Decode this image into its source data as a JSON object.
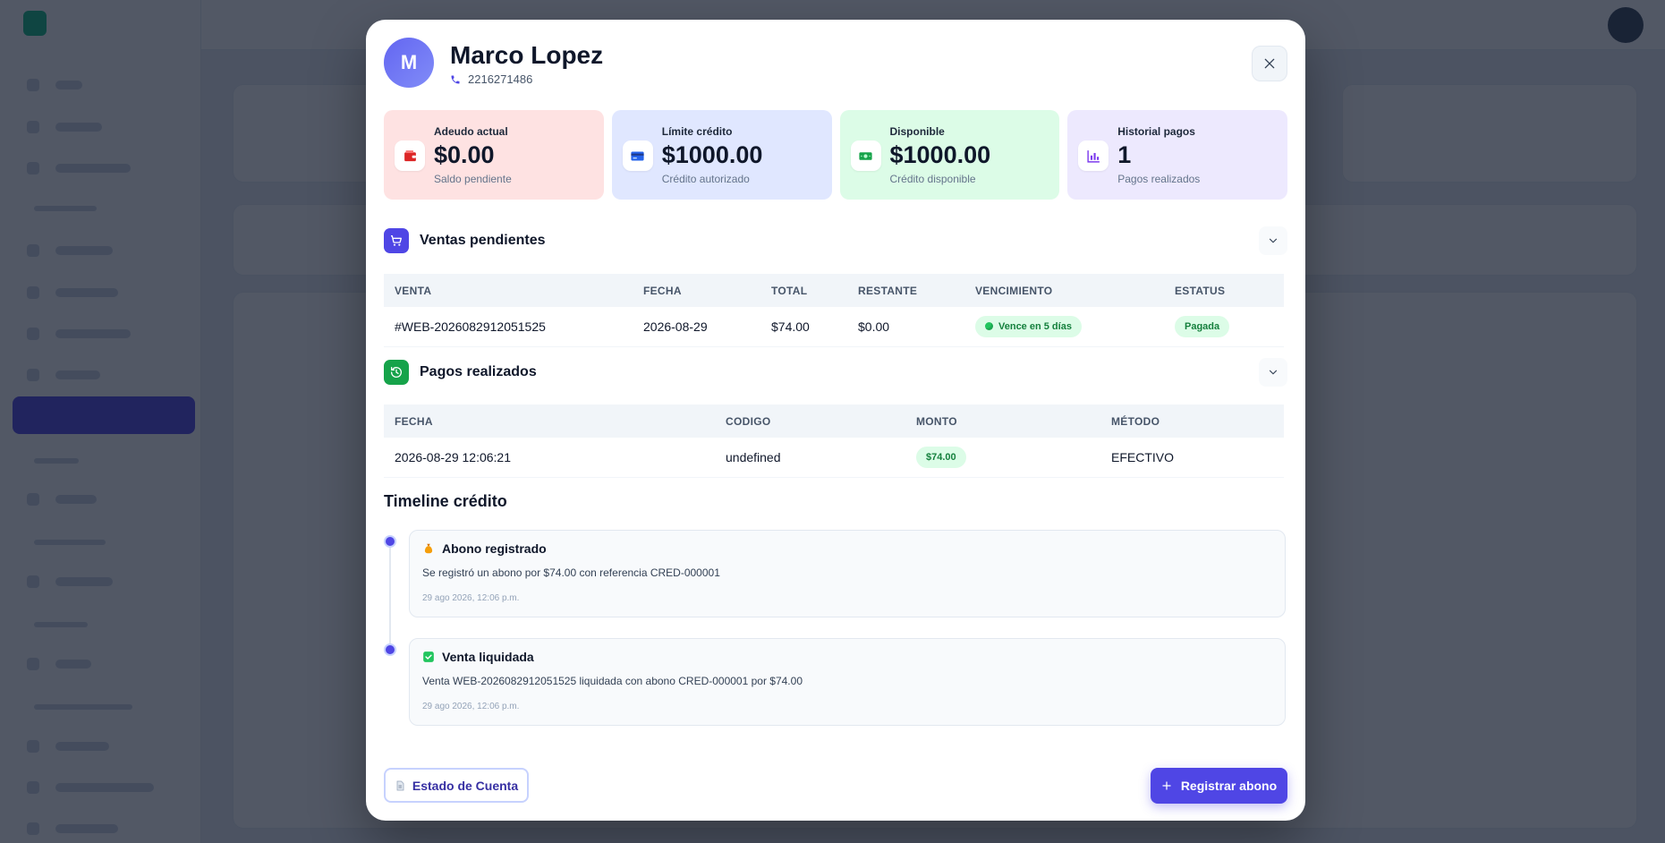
{
  "client": {
    "initial": "M",
    "name": "Marco Lopez",
    "phone": "2216271486"
  },
  "stats": [
    {
      "label": "Adeudo actual",
      "value": "$0.00",
      "sub": "Saldo pendiente",
      "icon": "wallet-icon",
      "bg": "#fee2e2",
      "color": "#dc2626"
    },
    {
      "label": "Límite crédito",
      "value": "$1000.00",
      "sub": "Crédito autorizado",
      "icon": "credit-card-icon",
      "bg": "#e0e7ff",
      "color": "#2563eb"
    },
    {
      "label": "Disponible",
      "value": "$1000.00",
      "sub": "Crédito disponible",
      "icon": "money-icon",
      "bg": "#dcfce7",
      "color": "#16a34a"
    },
    {
      "label": "Historial pagos",
      "value": "1",
      "sub": "Pagos realizados",
      "icon": "chart-icon",
      "bg": "#ede9fe",
      "color": "#7c3aed"
    }
  ],
  "pending_sales": {
    "title": "Ventas pendientes",
    "columns": [
      "VENTA",
      "FECHA",
      "TOTAL",
      "RESTANTE",
      "VENCIMIENTO",
      "ESTATUS"
    ],
    "rows": [
      {
        "venta": "#WEB-2026082912051525",
        "fecha": "2026-08-29",
        "total": "$74.00",
        "restante": "$0.00",
        "vencimiento": "Vence en 5 días",
        "estatus": "Pagada"
      }
    ]
  },
  "payments": {
    "title": "Pagos realizados",
    "columns": [
      "FECHA",
      "CODIGO",
      "MONTO",
      "MÉTODO"
    ],
    "rows": [
      {
        "fecha": "2026-08-29 12:06:21",
        "codigo": "undefined",
        "monto": "$74.00",
        "metodo": "EFECTIVO"
      }
    ]
  },
  "timeline": {
    "title": "Timeline crédito",
    "events": [
      {
        "title": "Abono registrado",
        "desc": "Se registró un abono por $74.00 con referencia CRED-000001",
        "date": "29 ago 2026, 12:06 p.m.",
        "icon": "money-bag-icon"
      },
      {
        "title": "Venta liquidada",
        "desc": "Venta WEB-2026082912051525 liquidada con abono CRED-000001 por $74.00",
        "date": "29 ago 2026, 12:06 p.m.",
        "icon": "check-icon"
      }
    ]
  },
  "actions": {
    "statement": "Estado de Cuenta",
    "register": "Registrar abono"
  },
  "colors": {
    "accent": "#4f46e5",
    "success": "#16a34a"
  }
}
